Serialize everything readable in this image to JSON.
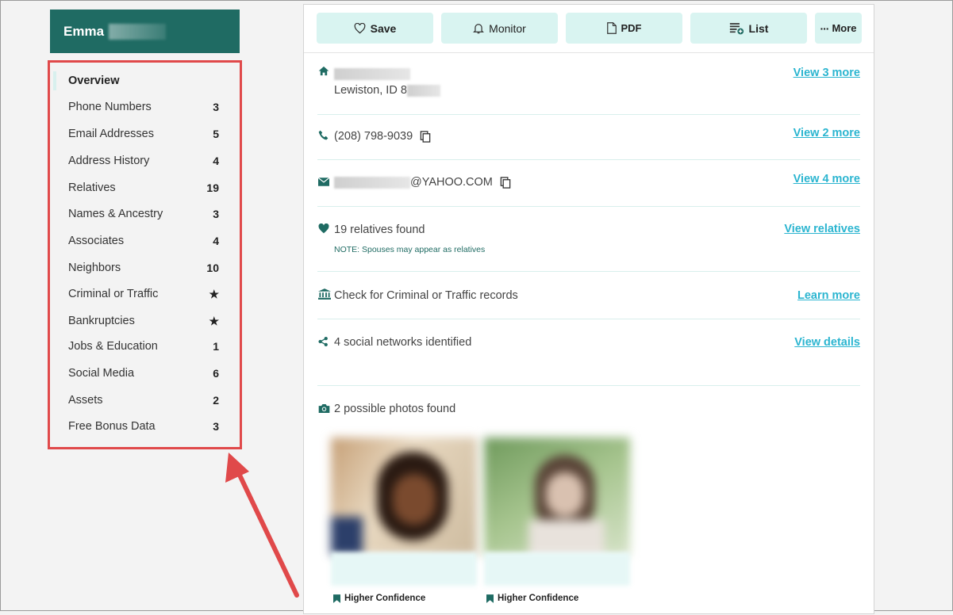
{
  "person": {
    "first_name": "Emma"
  },
  "sidebar": {
    "items": [
      {
        "label": "Overview",
        "count": ""
      },
      {
        "label": "Phone Numbers",
        "count": "3"
      },
      {
        "label": "Email Addresses",
        "count": "5"
      },
      {
        "label": "Address History",
        "count": "4"
      },
      {
        "label": "Relatives",
        "count": "19"
      },
      {
        "label": "Names & Ancestry",
        "count": "3"
      },
      {
        "label": "Associates",
        "count": "4"
      },
      {
        "label": "Neighbors",
        "count": "10"
      },
      {
        "label": "Criminal or Traffic",
        "count": "★"
      },
      {
        "label": "Bankruptcies",
        "count": "★"
      },
      {
        "label": "Jobs & Education",
        "count": "1"
      },
      {
        "label": "Social Media",
        "count": "6"
      },
      {
        "label": "Assets",
        "count": "2"
      },
      {
        "label": "Free Bonus Data",
        "count": "3"
      }
    ]
  },
  "toolbar": {
    "save": "Save",
    "monitor": "Monitor",
    "pdf": "PDF",
    "list": "List",
    "more": "More"
  },
  "overview": {
    "address": {
      "city_line": "Lewiston, ID 8",
      "link": "View 3 more"
    },
    "phone": {
      "number": "(208) 798-9039",
      "link": "View 2 more"
    },
    "email": {
      "domain": "@YAHOO.COM",
      "link": "View 4 more"
    },
    "relatives": {
      "text": "19 relatives found",
      "note": "NOTE: Spouses may appear as relatives",
      "link": "View relatives"
    },
    "criminal": {
      "text": "Check for Criminal or Traffic records",
      "link": "Learn more"
    },
    "social": {
      "text": "4 social networks identified",
      "link": "View details"
    },
    "photos": {
      "text": "2 possible photos found",
      "items": [
        {
          "confidence": "Higher Confidence"
        },
        {
          "confidence": "Higher Confidence"
        }
      ]
    }
  },
  "colors": {
    "brand_green": "#1f6b63",
    "button_bg": "#d9f4f1",
    "link": "#2bb5d0",
    "highlight_red": "#e0494a"
  }
}
